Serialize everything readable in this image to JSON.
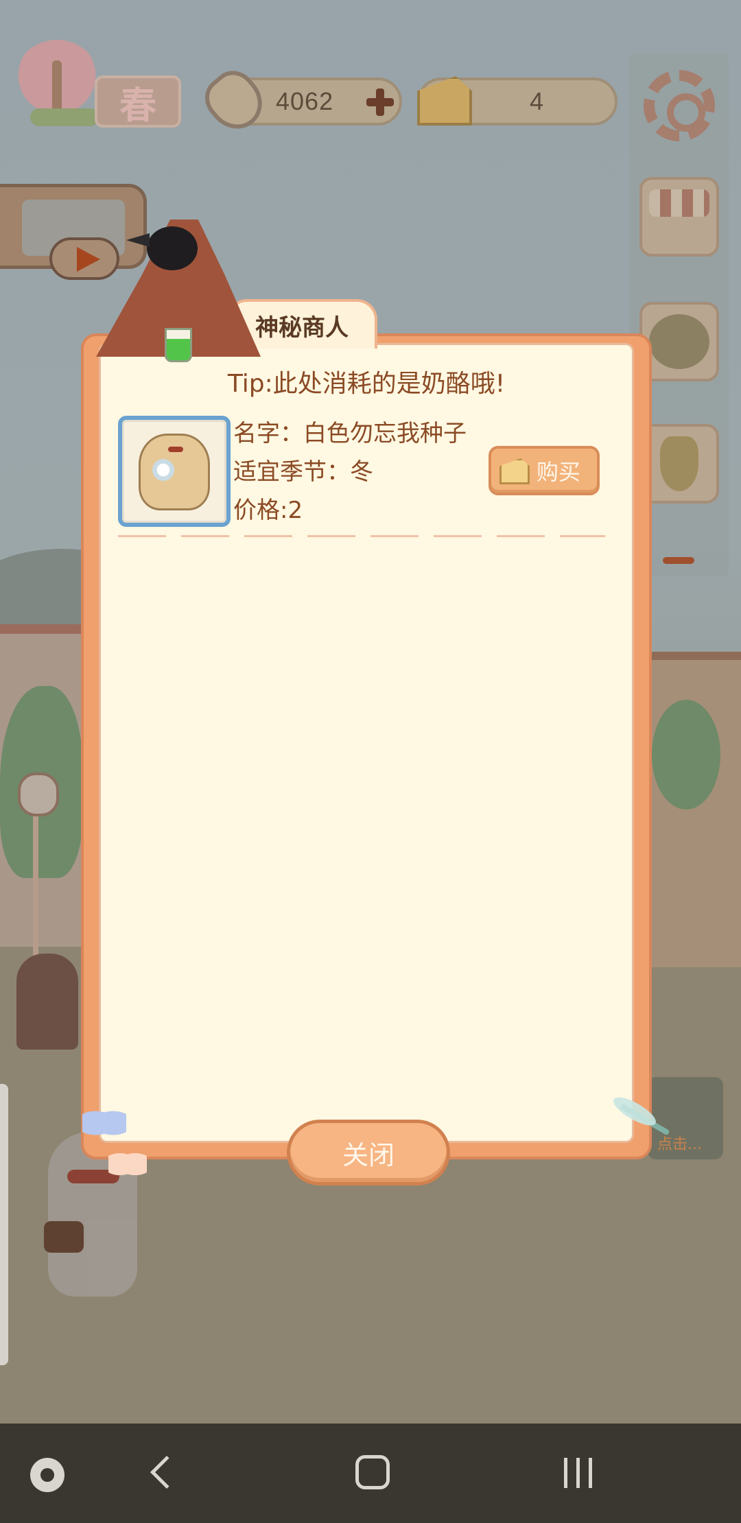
{
  "hud": {
    "season": "春",
    "fish_count": "4062",
    "cheese_count": "4"
  },
  "sidebar": {
    "items": [
      {
        "name": "settings",
        "icon": "gear-icon"
      },
      {
        "name": "shop",
        "icon": "market-stall-icon"
      },
      {
        "name": "basket",
        "icon": "flower-basket-icon"
      },
      {
        "name": "achievements",
        "icon": "trophy-icon"
      }
    ]
  },
  "dialog": {
    "title": "神秘商人",
    "tip": "Tip:此处消耗的是奶酪哦!",
    "items": [
      {
        "name": "名字：白色勿忘我种子",
        "season": "适宜季节：冬",
        "price": "价格:2",
        "buy_label": "购买",
        "icon": "seed-bag-icon"
      }
    ],
    "close_label": "关闭"
  },
  "mouse_panel": {
    "text": "点击..."
  },
  "colors": {
    "dialog_frame": "#f0a06d",
    "dialog_bg": "#fff8e2",
    "text_brown": "#8a4a24",
    "thumb_border": "#6aa2d0"
  }
}
